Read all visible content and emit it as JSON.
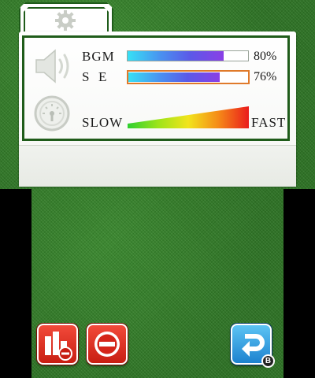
{
  "settings": {
    "tab_icon": "gear-icon",
    "volume_icon": "speaker-icon",
    "speed_icon": "speedometer-icon",
    "bgm": {
      "label": "BGM",
      "value_text": "80%",
      "level": 0.8
    },
    "se": {
      "label": "S  E",
      "value_text": "76%",
      "level": 0.76,
      "selected": true
    },
    "speed": {
      "slow_label": "SLOW",
      "fast_label": "FAST"
    }
  },
  "toolbar": {
    "stats_icon": "stats-minus-icon",
    "no_entry_icon": "no-entry-icon",
    "back_icon": "back-arrow-icon",
    "back_badge": "B"
  },
  "colors": {
    "felt": "#2f7a25",
    "frame": "#1f5c1a",
    "selected_outline": "#e07a2a",
    "red_button": "#d9281a",
    "blue_button": "#2b94dc"
  }
}
